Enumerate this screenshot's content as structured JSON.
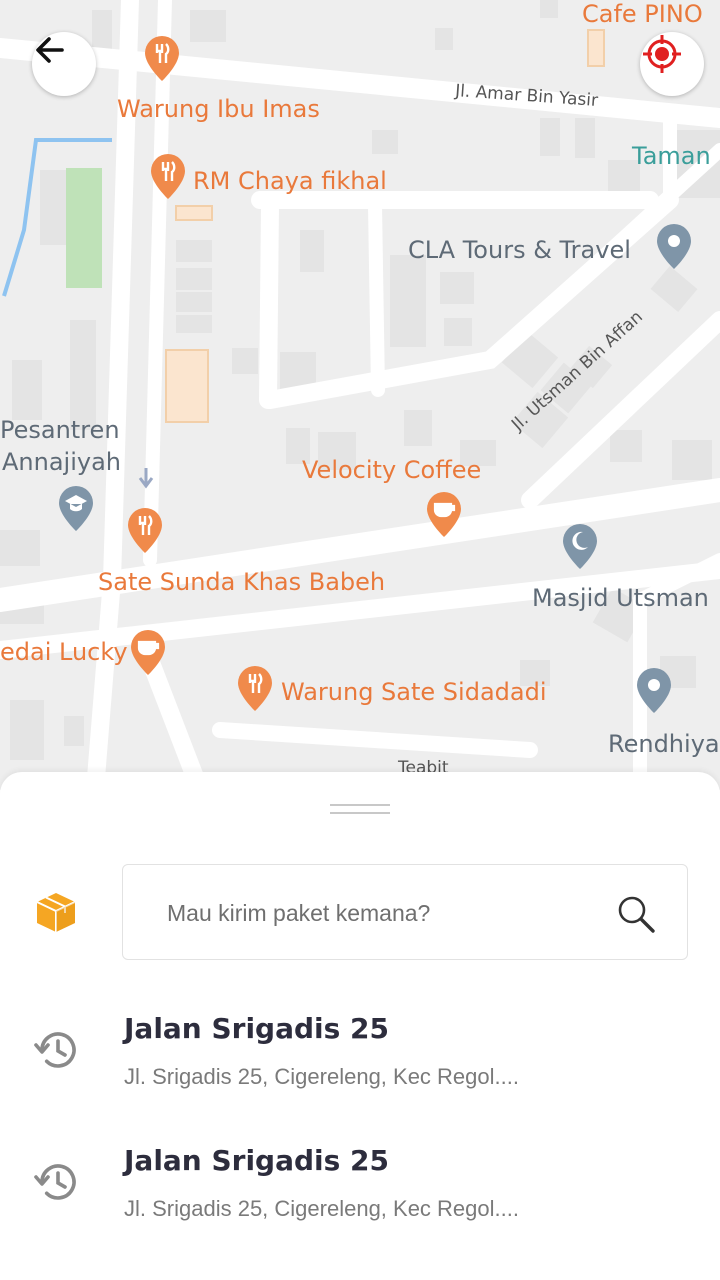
{
  "map": {
    "streets": [
      "Jl. Amar Bin Yasir",
      "Jl. Utsman Bin Affan",
      "Teabit"
    ],
    "pois": [
      {
        "name": "Cafe PINO",
        "kind": "cafe"
      },
      {
        "name": "Warung Ibu Imas",
        "kind": "restaurant"
      },
      {
        "name": "RM Chaya fikhal",
        "kind": "restaurant"
      },
      {
        "name": "Taman",
        "kind": "park"
      },
      {
        "name": "CLA Tours & Travel",
        "kind": "place"
      },
      {
        "name": "Pesantren",
        "kind": "school"
      },
      {
        "name": "Annajiyah",
        "kind": "school"
      },
      {
        "name": "Velocity Coffee",
        "kind": "cafe"
      },
      {
        "name": "Sate Sunda Khas Babeh",
        "kind": "restaurant"
      },
      {
        "name": "Masjid Utsman",
        "kind": "mosque"
      },
      {
        "name": "edai Lucky",
        "kind": "cafe"
      },
      {
        "name": "Warung Sate Sidadadi",
        "kind": "restaurant"
      },
      {
        "name": "Rendhiya",
        "kind": "place"
      }
    ],
    "colors": {
      "poi_food": "#e9793b",
      "poi_place": "#5e6a76",
      "poi_park": "#3a9e9a",
      "pin_gray": "#7f95a8"
    },
    "back_icon": "arrow-left-icon",
    "locate_icon": "crosshair-icon"
  },
  "sheet": {
    "search": {
      "placeholder": "Mau kirim paket kemana?",
      "value": ""
    },
    "package_icon": "package-box-icon",
    "recent": [
      {
        "title": "Jalan Srigadis 25",
        "subtitle": "Jl. Srigadis 25, Cigereleng, Kec Regol....",
        "icon": "history-icon"
      },
      {
        "title": "Jalan Srigadis 25",
        "subtitle": "Jl. Srigadis 25, Cigereleng, Kec Regol....",
        "icon": "history-icon"
      }
    ]
  },
  "colors": {
    "accent": "#f5a623",
    "title": "#2d2d3d",
    "subtitle": "#7a7a7a",
    "locate_red": "#e02020"
  }
}
